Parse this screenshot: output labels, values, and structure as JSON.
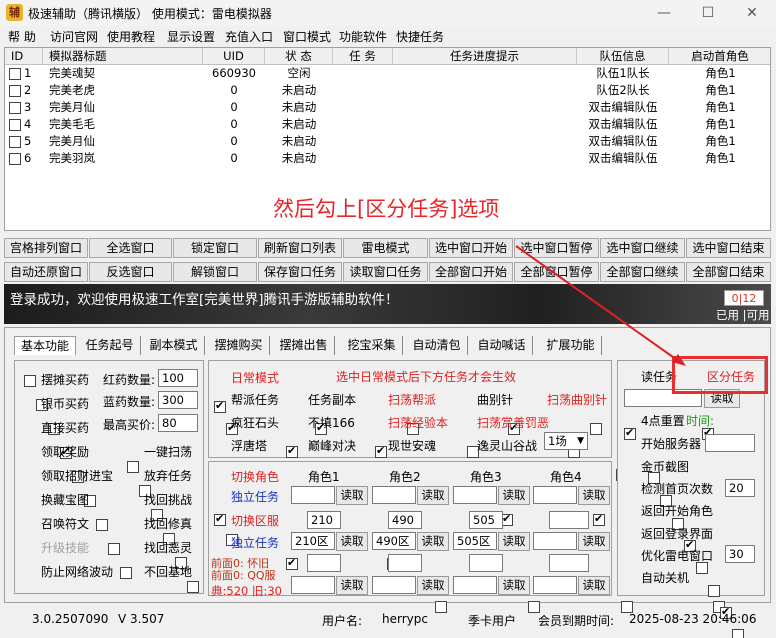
{
  "window": {
    "title": "极速辅助（腾讯横版）  使用模式：雷电模拟器",
    "minimize": "—",
    "maximize": "☐",
    "close": "✕"
  },
  "menu": [
    "帮 助",
    "访问官网",
    "使用教程",
    "显示设置",
    "充值入口",
    "窗口模式",
    "功能软件",
    "快捷任务"
  ],
  "table": {
    "headers": [
      "ID",
      "模拟器标题",
      "UID",
      "状  态",
      "任  务",
      "任务进度提示",
      "队伍信息",
      "启动首角色"
    ],
    "rows": [
      {
        "id": "1",
        "title": "完美魂契",
        "uid": "660930",
        "status": "空闲",
        "task": "",
        "progress": "",
        "team": "队伍1队长",
        "role": "角色1"
      },
      {
        "id": "2",
        "title": "完美老虎",
        "uid": "0",
        "status": "未启动",
        "task": "",
        "progress": "",
        "team": "队伍2队长",
        "role": "角色1"
      },
      {
        "id": "3",
        "title": "完美月仙",
        "uid": "0",
        "status": "未启动",
        "task": "",
        "progress": "",
        "team": "双击编辑队伍",
        "role": "角色1"
      },
      {
        "id": "4",
        "title": "完美毛毛",
        "uid": "0",
        "status": "未启动",
        "task": "",
        "progress": "",
        "team": "双击编辑队伍",
        "role": "角色1"
      },
      {
        "id": "5",
        "title": "完美月仙",
        "uid": "0",
        "status": "未启动",
        "task": "",
        "progress": "",
        "team": "双击编辑队伍",
        "role": "角色1"
      },
      {
        "id": "6",
        "title": "完美羽岚",
        "uid": "0",
        "status": "未启动",
        "task": "",
        "progress": "",
        "team": "双击编辑队伍",
        "role": "角色1"
      }
    ]
  },
  "annotation": "然后勾上[区分任务]选项",
  "buttons_row1": [
    "宫格排列窗口",
    "全选窗口",
    "锁定窗口",
    "刷新窗口列表",
    "雷电模式",
    "选中窗口开始",
    "选中窗口暂停",
    "选中窗口继续",
    "选中窗口结束"
  ],
  "buttons_row2": [
    "自动还原窗口",
    "反选窗口",
    "解锁窗口",
    "保存窗口任务",
    "读取窗口任务",
    "全部窗口开始",
    "全部窗口暂停",
    "全部窗口继续",
    "全部窗口结束"
  ],
  "status": {
    "message": "登录成功，欢迎使用极速工作室[完美世界]腾讯手游版辅助软件！",
    "count": "0|12",
    "count_label": "已用 |可用"
  },
  "tabs": [
    "基本功能",
    "任务起号",
    "副本模式",
    "摆摊购买",
    "摆摊出售",
    "挖宝采集",
    "自动清包",
    "自动喊话",
    "扩展功能"
  ],
  "basic": {
    "left": [
      {
        "label": "摆摊买药",
        "checked": false
      },
      {
        "label": "银币买药",
        "checked": false
      },
      {
        "label": "直接买药",
        "checked": false
      },
      {
        "label": "领取奖励",
        "checked": true
      },
      {
        "label": "领取招财进宝",
        "checked": false
      },
      {
        "label": "换藏宝图",
        "checked": false
      },
      {
        "label": "召唤符文",
        "checked": false
      },
      {
        "label": "升级技能",
        "checked": false,
        "disabled": true
      },
      {
        "label": "防止网络波动",
        "checked": false
      }
    ],
    "red_label": "红药数量:",
    "red_val": "100",
    "blue_label": "蓝药数量:",
    "blue_val": "300",
    "maxprice_label": "最高买价:",
    "maxprice_val": "80",
    "right": [
      {
        "label": "一键扫荡",
        "checked": false
      },
      {
        "label": "放弃任务",
        "checked": false
      },
      {
        "label": "找回挑战",
        "checked": false
      },
      {
        "label": "找回修真",
        "checked": false
      },
      {
        "label": "找回恶灵",
        "checked": false
      },
      {
        "label": "不回基地",
        "checked": false
      }
    ]
  },
  "daily": {
    "mode": {
      "label": "日常模式",
      "checked": true
    },
    "hint": "选中日常模式后下方任务才会生效",
    "items": [
      {
        "label": "帮派任务",
        "checked": true
      },
      {
        "label": "任务副本",
        "checked": true
      },
      {
        "label": "扫荡帮派",
        "checked": false,
        "red": true
      },
      {
        "label": "曲别针",
        "checked": true
      },
      {
        "label": "扫荡曲别针",
        "checked": false,
        "red": true
      },
      {
        "label": "疯狂石头",
        "checked": true
      },
      {
        "label": "不填166",
        "checked": true
      },
      {
        "label": "扫荡经验本",
        "checked": false,
        "red": true
      },
      {
        "label": "扫荡赏善罚恶",
        "checked": false,
        "red": true
      },
      {
        "label": "浮唐塔",
        "checked": true
      },
      {
        "label": "巅峰对决",
        "checked": true
      },
      {
        "label": "现世安魂",
        "checked": true
      },
      {
        "label": "逸灵山谷战",
        "checked": false
      }
    ],
    "rounds": "1场"
  },
  "roles": {
    "switch_role": "切换角色",
    "switch_role_checked": true,
    "independent": "独立任务",
    "independent_checked": false,
    "role_cols": [
      {
        "label": "角色1",
        "checked": false
      },
      {
        "label": "角色2",
        "checked": true
      },
      {
        "label": "角色3",
        "checked": true
      },
      {
        "label": "角色4",
        "checked": true
      }
    ],
    "read": "读取",
    "switch_server": "切换区服",
    "switch_server_checked": true,
    "independent2": "独立任务",
    "independent2_checked": true,
    "servers": [
      {
        "checked": true,
        "val": "210",
        "name": "210区"
      },
      {
        "checked": true,
        "val": "490",
        "name": "490区"
      },
      {
        "checked": true,
        "val": "505",
        "name": "505区"
      },
      {
        "checked": false,
        "val": "",
        "name": ""
      }
    ],
    "front_wx": "前面0: 怀旧",
    "front_qq": "前面0: QQ服",
    "bottom_note": "典:520 旧:30"
  },
  "side": {
    "read_task": {
      "label": "读任务",
      "checked": true
    },
    "split_task": {
      "label": "区分任务",
      "checked": true
    },
    "read_btn": "读取",
    "reset4": {
      "label": "4点重置",
      "checked": false
    },
    "time_label": "时间:",
    "server": {
      "label": "开始服务器",
      "checked": false
    },
    "gold": {
      "label": "金币截图",
      "checked": false
    },
    "detect": {
      "label": "检测首页次数",
      "checked": true
    },
    "detect_val": "20",
    "back_start": {
      "label": "返回开始角色",
      "checked": false
    },
    "back_login": {
      "label": "返回登录界面",
      "checked": false
    },
    "optimize": {
      "label": "优化雷电窗口",
      "checked": true
    },
    "optimize_val": "30",
    "auto_shutdown": {
      "label": "自动关机",
      "checked": false
    }
  },
  "footer": {
    "version": "3.0.2507090",
    "v": "V 3.507",
    "user_label": "用户名:",
    "user": "herrypc",
    "card": "季卡用户",
    "expire_label": "会员到期时间:",
    "expire": "2025-08-23 20:46:06"
  },
  "colors": {
    "accent_red": "#e02020",
    "blue": "#1a30c0",
    "green": "#1a9a1a"
  }
}
